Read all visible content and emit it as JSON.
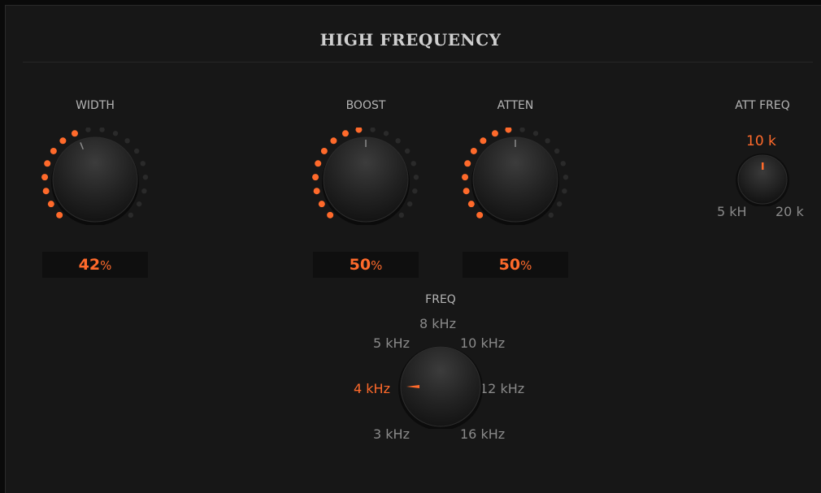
{
  "title": "HIGH FREQUENCY",
  "accent_color": "#ff6a2b",
  "width": {
    "label": "WIDTH",
    "value": "42",
    "unit": "%",
    "level": 0.42
  },
  "boost": {
    "label": "BOOST",
    "value": "50",
    "unit": "%",
    "level": 0.5
  },
  "atten": {
    "label": "ATTEN",
    "value": "50",
    "unit": "%",
    "level": 0.5
  },
  "att_freq": {
    "label": "ATT FREQ",
    "value": "10 k",
    "min_label": "5 kH",
    "max_label": "20 k"
  },
  "freq": {
    "label": "FREQ",
    "selected": "4 kHz",
    "options": [
      "3 kHz",
      "4 kHz",
      "5 kHz",
      "8 kHz",
      "10 kHz",
      "12 kHz",
      "16 kHz"
    ]
  }
}
